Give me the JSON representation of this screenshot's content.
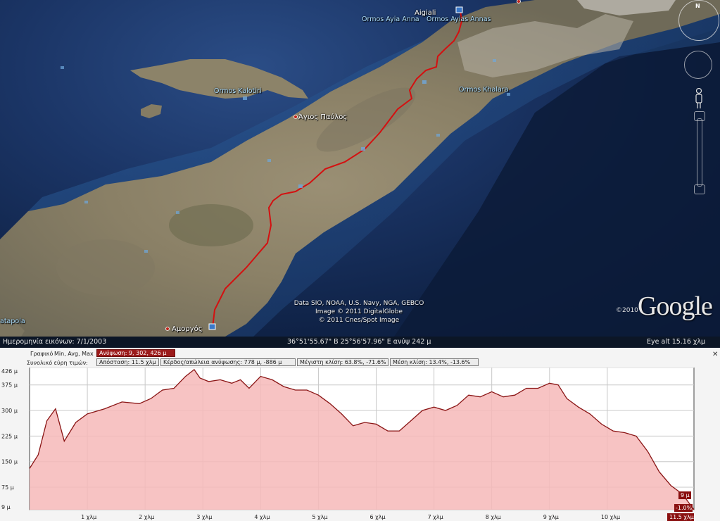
{
  "map": {
    "places": [
      {
        "id": "aigiali",
        "label": "Aigiali",
        "style": "white"
      },
      {
        "id": "ormos-ayia-anna-left",
        "label": "Ormos Ayia Anna",
        "style": "blue"
      },
      {
        "id": "ormos-ayias-annas",
        "label": "Ormos Ayias Annas",
        "style": "blue"
      },
      {
        "id": "ormos-kalotiri",
        "label": "Ormos Kalotiri",
        "style": "blue"
      },
      {
        "id": "agios-pavlos",
        "label": "Άγιος Παύλος",
        "style": "white"
      },
      {
        "id": "ormos-khalara",
        "label": "Ormos Khalara",
        "style": "blue"
      },
      {
        "id": "katapola",
        "label": "atapola",
        "style": "blue"
      },
      {
        "id": "amorgos",
        "label": "Αμοργός",
        "style": "white"
      }
    ],
    "attribution": [
      "Data SIO, NOAA, U.S. Navy, NGA, GEBCO",
      "Image © 2011 DigitalGlobe",
      "© 2011 Cnes/Spot Image"
    ],
    "google_logo": "Google",
    "google_year": "©2010",
    "compass_label": "N",
    "icons": [
      "compass-icon",
      "look-control-icon",
      "pegman-icon",
      "zoom-in-icon",
      "zoom-out-icon",
      "photo-marker-icon"
    ],
    "route_color": "#d41010"
  },
  "statusbar": {
    "imagery_date": "Ημερομηνία εικόνων: 7/1/2003",
    "coordinates": "36°51'55.67\" Β  25°56'57.96\" Ε  ανύψ  242 μ",
    "eye_alt": "Eye alt   15.16 χλμ"
  },
  "elevation_panel": {
    "graph_label": "Γραφικό",
    "graph_value": "Min, Avg, Max",
    "elevation_box": "Ανύψωση: 9, 302, 426 μ",
    "range_label": "Συνολικό εύρη τιμών:",
    "distance_box": "Απόσταση: 11.5 χλμ",
    "gain_loss_box": "Κέρδος/απώλεια ανύψωσης: 778 μ, -886 μ",
    "max_slope_box": "Μέγιστη κλίση: 63.8%, -71.6%",
    "avg_slope_box": "Μέση κλίση: 13.4%, -13.6%",
    "close_icon": "close-icon"
  },
  "chart_data": {
    "type": "area",
    "xlabel": "",
    "ylabel": "",
    "xlim": [
      0,
      11.5
    ],
    "ylim": [
      9,
      426
    ],
    "y_ticks": [
      "426 μ",
      "375 μ",
      "300 μ",
      "225 μ",
      "150 μ",
      "75 μ",
      "9 μ"
    ],
    "y_tick_values": [
      426,
      375,
      300,
      225,
      150,
      75,
      9
    ],
    "x_ticks": [
      "1 χλμ",
      "2 χλμ",
      "3 χλμ",
      "4 χλμ",
      "5 χλμ",
      "6 χλμ",
      "7 χλμ",
      "8 χλμ",
      "9 χλμ",
      "10 χλμ"
    ],
    "x_tick_values": [
      1,
      2,
      3,
      4,
      5,
      6,
      7,
      8,
      9,
      10
    ],
    "end_x_label": "11.5 χλμ",
    "end_value_label": "9 μ",
    "end_slope_label": "-1.0%",
    "grid": true,
    "line_color": "#8a1515",
    "fill_color": "#f6b8b8",
    "series": [
      {
        "x": [
          0,
          0.15,
          0.3,
          0.45,
          0.6,
          0.8,
          1.0,
          1.3,
          1.6,
          1.9,
          2.1,
          2.3,
          2.5,
          2.7,
          2.85,
          2.95,
          3.1,
          3.3,
          3.5,
          3.65,
          3.8,
          4.0,
          4.2,
          4.4,
          4.6,
          4.8,
          5.0,
          5.2,
          5.4,
          5.6,
          5.8,
          6.0,
          6.2,
          6.4,
          6.6,
          6.8,
          7.0,
          7.2,
          7.4,
          7.6,
          7.8,
          8.0,
          8.2,
          8.4,
          8.6,
          8.8,
          9.0,
          9.15,
          9.3,
          9.5,
          9.7,
          9.9,
          10.1,
          10.3,
          10.5,
          10.7,
          10.9,
          11.1,
          11.3,
          11.5
        ],
        "y": [
          130,
          170,
          270,
          305,
          210,
          265,
          290,
          305,
          325,
          320,
          335,
          360,
          365,
          400,
          420,
          395,
          385,
          390,
          380,
          390,
          365,
          400,
          390,
          370,
          360,
          360,
          345,
          320,
          290,
          255,
          265,
          260,
          240,
          240,
          270,
          300,
          310,
          300,
          315,
          345,
          340,
          355,
          340,
          345,
          365,
          365,
          380,
          375,
          335,
          310,
          290,
          260,
          240,
          235,
          225,
          180,
          120,
          80,
          55,
          9
        ]
      }
    ]
  }
}
